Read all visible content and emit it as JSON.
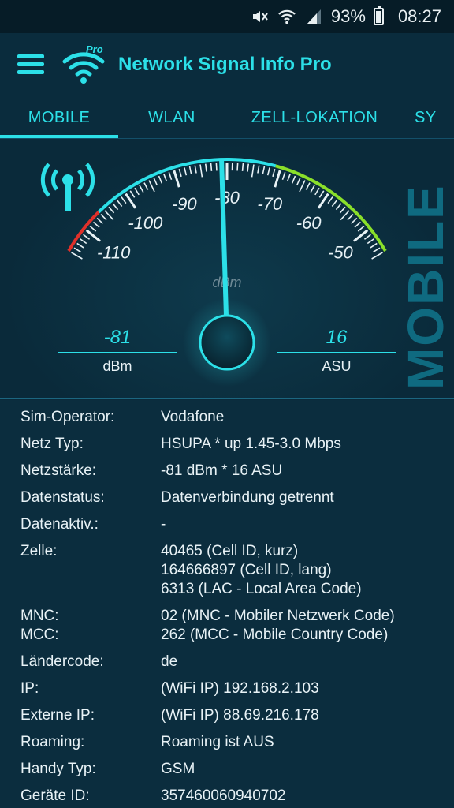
{
  "status_bar": {
    "battery": "93%",
    "time": "08:27",
    "icons": [
      "mute-icon",
      "wifi-icon",
      "cell-signal-icon",
      "battery-icon"
    ]
  },
  "app": {
    "title": "Network Signal Info Pro",
    "logo_badge": "Pro"
  },
  "tabs": [
    {
      "label": "MOBILE",
      "active": true
    },
    {
      "label": "WLAN",
      "active": false
    },
    {
      "label": "ZELL-LOKATION",
      "active": false
    },
    {
      "label": "SY",
      "active": false
    }
  ],
  "gauge": {
    "unit_label": "dBm",
    "scale_labels": [
      "-110",
      "-100",
      "-90",
      "-80",
      "-70",
      "-60",
      "-50"
    ],
    "scale_min": -115,
    "scale_max": -45,
    "needle_value": -81,
    "side_label": "MOBILE",
    "left_readout": {
      "value": "-81",
      "unit": "dBm"
    },
    "right_readout": {
      "value": "16",
      "unit": "ASU"
    },
    "colors": {
      "accent": "#2ce0e8",
      "red": "#e0302a",
      "green": "#8adf2a"
    }
  },
  "info": [
    {
      "key": "Sim-Operator:",
      "value": [
        "Vodafone"
      ]
    },
    {
      "key": "Netz Typ:",
      "value": [
        "HSUPA * up 1.45-3.0 Mbps"
      ]
    },
    {
      "key": "Netzstärke:",
      "value": [
        "-81 dBm * 16 ASU"
      ]
    },
    {
      "key": "Datenstatus:",
      "value": [
        "Datenverbindung getrennt"
      ]
    },
    {
      "key": "Datenaktiv.:",
      "value": [
        "-"
      ]
    },
    {
      "key": "Zelle:",
      "value": [
        "40465 (Cell ID, kurz)",
        "164666897 (Cell ID, lang)",
        "6313 (LAC - Local Area Code)"
      ]
    },
    {
      "key": "MNC:\nMCC:",
      "value": [
        "02 (MNC - Mobiler Netzwerk Code)",
        "262 (MCC - Mobile Country Code)"
      ]
    },
    {
      "key": "Ländercode:",
      "value": [
        "de"
      ]
    },
    {
      "key": "IP:",
      "value": [
        "(WiFi IP) 192.168.2.103"
      ]
    },
    {
      "key": "Externe IP:",
      "value": [
        "(WiFi IP) 88.69.216.178"
      ]
    },
    {
      "key": "Roaming:",
      "value": [
        "Roaming ist AUS"
      ]
    },
    {
      "key": "Handy Typ:",
      "value": [
        "GSM"
      ]
    },
    {
      "key": "Geräte ID:",
      "value": [
        "357460060940702"
      ]
    }
  ]
}
